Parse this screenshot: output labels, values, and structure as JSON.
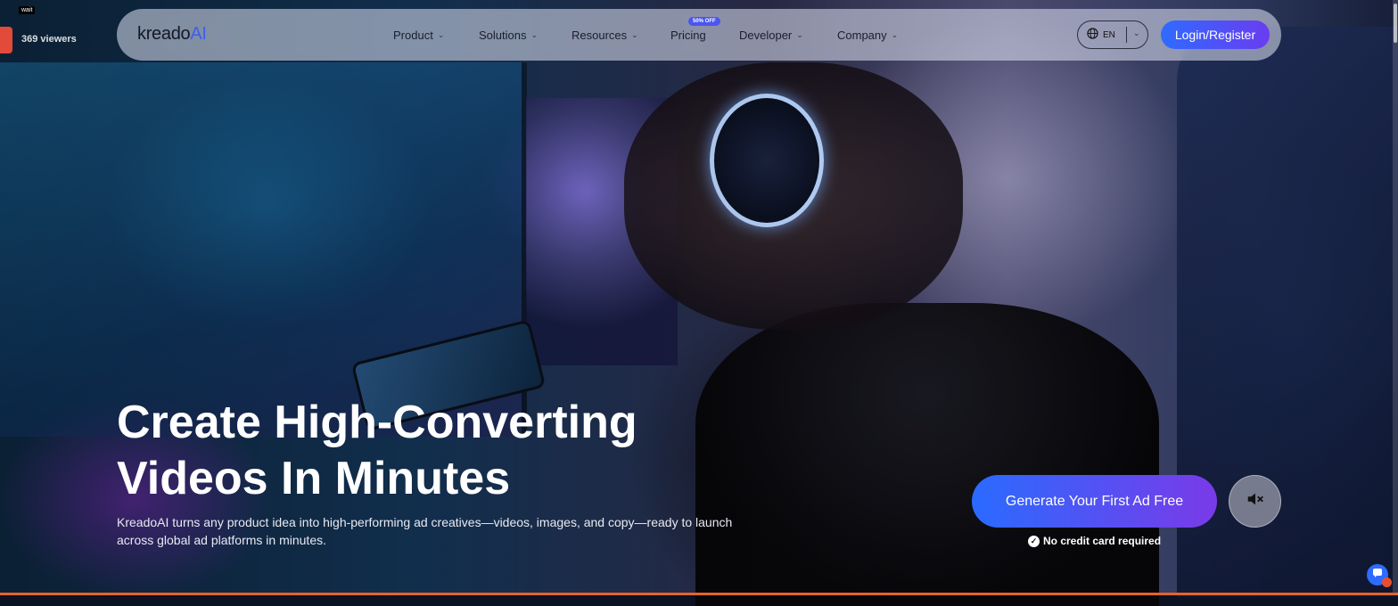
{
  "overlay": {
    "wait_tag": "wait",
    "viewers": "369 viewers"
  },
  "nav": {
    "logo_main": "kreado",
    "logo_accent": "AI",
    "items": [
      {
        "label": "Product"
      },
      {
        "label": "Solutions"
      },
      {
        "label": "Resources"
      },
      {
        "label": "Pricing",
        "badge": "50% OFF"
      },
      {
        "label": "Developer"
      },
      {
        "label": "Company"
      }
    ],
    "language": "EN",
    "login_label": "Login/Register"
  },
  "hero": {
    "title_line1": "Create High-Converting",
    "title_line2": "Videos In Minutes",
    "description": "KreadoAI turns any product idea into high-performing ad creatives—videos, images, and copy—ready to launch across global ad platforms in minutes.",
    "cta_label": "Generate Your First Ad Free",
    "note": "No credit card required"
  },
  "colors": {
    "accent_start": "#2a6bff",
    "accent_end": "#7a3ae8",
    "badge": "#4b55f0"
  },
  "icons": {
    "nav_chevron": "chevron-down-icon",
    "language": "globe-icon",
    "mute": "speaker-mute-icon",
    "note": "check-circle-icon",
    "chat": "chat-icon"
  }
}
